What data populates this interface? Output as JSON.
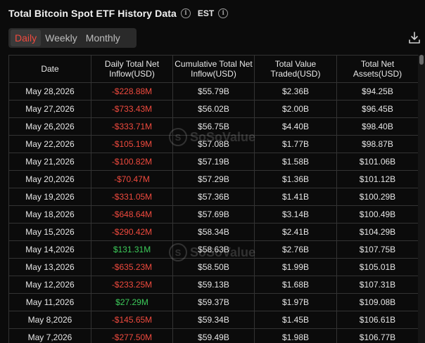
{
  "header": {
    "title": "Total Bitcoin Spot ETF History Data",
    "timezone": "EST"
  },
  "tabs": [
    {
      "label": "Daily",
      "active": true
    },
    {
      "label": "Weekly",
      "active": false
    },
    {
      "label": "Monthly",
      "active": false
    }
  ],
  "table": {
    "columns": [
      "Date",
      "Daily Total Net Inflow(USD)",
      "Cumulative Total Net Inflow(USD)",
      "Total Value Traded(USD)",
      "Total Net Assets(USD)"
    ],
    "rows": [
      [
        "May 28,2026",
        "-$228.88M",
        "$55.79B",
        "$2.36B",
        "$94.25B"
      ],
      [
        "May 27,2026",
        "-$733.43M",
        "$56.02B",
        "$2.00B",
        "$96.45B"
      ],
      [
        "May 26,2026",
        "-$333.71M",
        "$56.75B",
        "$4.40B",
        "$98.40B"
      ],
      [
        "May 22,2026",
        "-$105.19M",
        "$57.08B",
        "$1.77B",
        "$98.87B"
      ],
      [
        "May 21,2026",
        "-$100.82M",
        "$57.19B",
        "$1.58B",
        "$101.06B"
      ],
      [
        "May 20,2026",
        "-$70.47M",
        "$57.29B",
        "$1.36B",
        "$101.12B"
      ],
      [
        "May 19,2026",
        "-$331.05M",
        "$57.36B",
        "$1.41B",
        "$100.29B"
      ],
      [
        "May 18,2026",
        "-$648.64M",
        "$57.69B",
        "$3.14B",
        "$100.49B"
      ],
      [
        "May 15,2026",
        "-$290.42M",
        "$58.34B",
        "$2.41B",
        "$104.29B"
      ],
      [
        "May 14,2026",
        "$131.31M",
        "$58.63B",
        "$2.76B",
        "$107.75B"
      ],
      [
        "May 13,2026",
        "-$635.23M",
        "$58.50B",
        "$1.99B",
        "$105.01B"
      ],
      [
        "May 12,2026",
        "-$233.25M",
        "$59.13B",
        "$1.68B",
        "$107.31B"
      ],
      [
        "May 11,2026",
        "$27.29M",
        "$59.37B",
        "$1.97B",
        "$109.08B"
      ],
      [
        "May 8,2026",
        "-$145.65M",
        "$59.34B",
        "$1.45B",
        "$106.61B"
      ],
      [
        "May 7,2026",
        "-$277.50M",
        "$59.49B",
        "$1.98B",
        "$106.77B"
      ]
    ]
  },
  "watermark": {
    "brand": "SoSoValue"
  },
  "colors": {
    "negative": "#f04a3e",
    "positive": "#3ccb5a",
    "active_tab": "#f04a3e"
  }
}
